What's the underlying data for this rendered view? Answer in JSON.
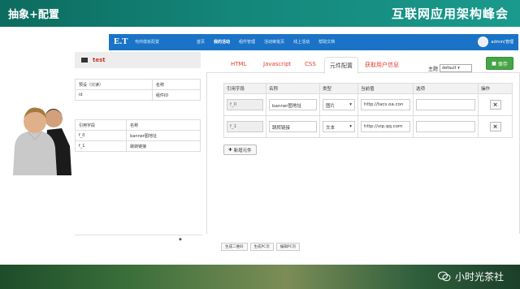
{
  "slide": {
    "title": "抽象+配置",
    "brand": "互联网应用架构峰会"
  },
  "app": {
    "logo": "E.T",
    "logo_sub": "电商模板配置",
    "nav": [
      "首页",
      "我的活动",
      "组件管理",
      "活动审批页",
      "线上活动",
      "帮助文档"
    ],
    "user": "admin(管理"
  },
  "left": {
    "title": "test",
    "params_table": {
      "headers": [
        "预设（只读）",
        "名称"
      ],
      "rows": [
        [
          "id",
          "组件ID"
        ]
      ]
    },
    "fields_table": {
      "headers": [
        "引用字段",
        "名称"
      ],
      "rows": [
        [
          "f_0",
          "banner图地址"
        ],
        [
          "f_1",
          "跳转链接"
        ]
      ]
    }
  },
  "right": {
    "tabs": [
      "HTML",
      "Javascript",
      "CSS",
      "元件配置",
      "获取用户信息"
    ],
    "active_tab": "元件配置",
    "theme_label": "主题",
    "theme_value": "default",
    "save_label": "保存",
    "table": {
      "headers": [
        "引用字段",
        "名称",
        "类型",
        "当前值",
        "选项",
        "操作"
      ],
      "rows": [
        {
          "field": "f_0",
          "name": "banner图地址",
          "type": "图片",
          "value": "http://tacs.oa.con",
          "option": ""
        },
        {
          "field": "f_1",
          "name": "跳转链接",
          "type": "文本",
          "value": "http://vip.qq.com",
          "option": ""
        }
      ],
      "delete_label": "×"
    },
    "add_label": "新增元件"
  },
  "bottom_buttons": [
    "生成二维码",
    "生成PC页",
    "编辑PC页"
  ],
  "splitter": "◆",
  "footer": {
    "account": "小时光茶社"
  },
  "colors": {
    "header": "#14867a",
    "nav": "#1a73c6",
    "tab_text": "#e03c31",
    "save": "#46a546"
  },
  "icons": [
    "list-icon",
    "save-icon",
    "plus-icon",
    "wechat-icon",
    "caret-down-icon",
    "user-avatar-icon"
  ]
}
